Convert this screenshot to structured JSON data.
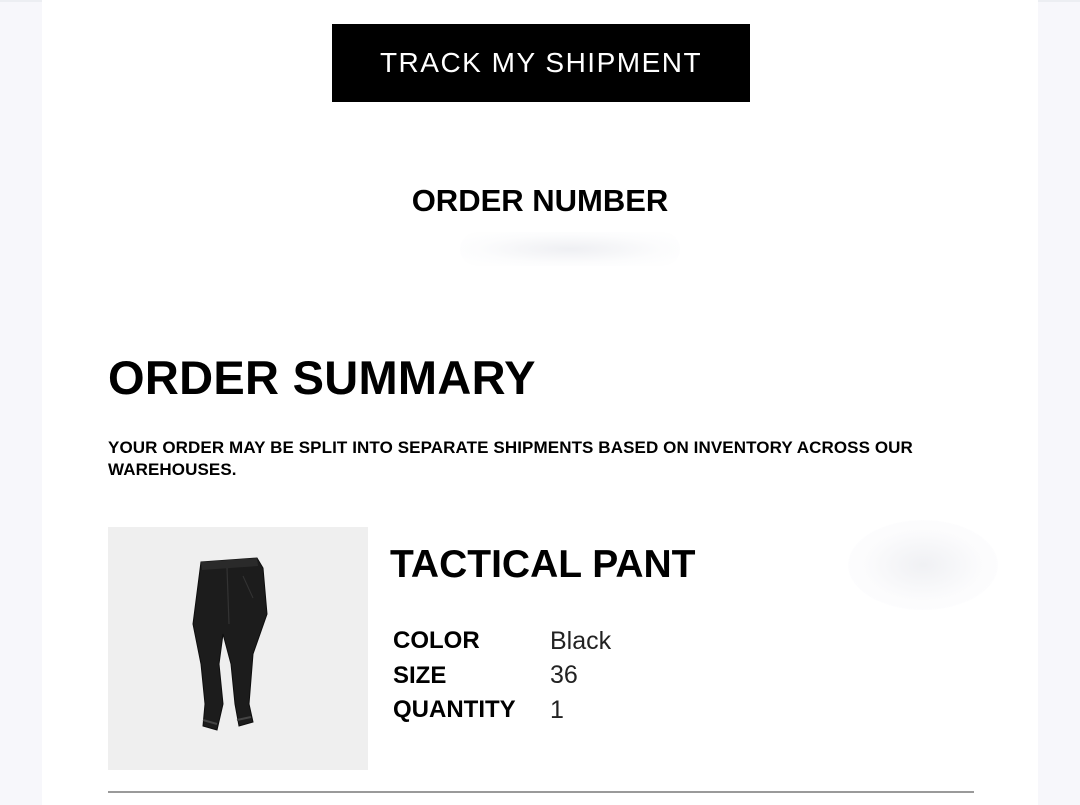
{
  "header": {
    "track_button_label": "TRACK MY SHIPMENT"
  },
  "order_number": {
    "label": "ORDER NUMBER"
  },
  "summary": {
    "title": "ORDER SUMMARY",
    "split_note": "YOUR ORDER MAY BE SPLIT INTO SEPARATE SHIPMENTS BASED ON INVENTORY ACROSS OUR WAREHOUSES."
  },
  "item": {
    "name": "TACTICAL PANT",
    "image_icon": "pants-icon",
    "attributes": [
      {
        "label": "COLOR",
        "value": "Black"
      },
      {
        "label": "SIZE",
        "value": "36"
      },
      {
        "label": "QUANTITY",
        "value": "1"
      }
    ]
  },
  "colors": {
    "button_bg": "#000000",
    "image_bg": "#efefef"
  }
}
